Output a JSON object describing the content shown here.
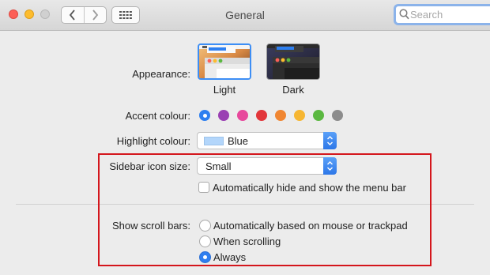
{
  "window": {
    "title": "General",
    "search": {
      "placeholder": "Search",
      "value": ""
    },
    "icons": {
      "back": "chevron-left-icon",
      "forward": "chevron-right-icon",
      "grid": "grid-icon",
      "search": "search-icon"
    }
  },
  "appearance": {
    "label": "Appearance:",
    "options": [
      {
        "name": "Light",
        "selected": true
      },
      {
        "name": "Dark",
        "selected": false
      }
    ]
  },
  "accent": {
    "label": "Accent colour:",
    "colors": [
      "#2d7ff0",
      "#9a3fb3",
      "#e7489c",
      "#e2363a",
      "#f08632",
      "#f6b632",
      "#5bb841",
      "#8c8c8c"
    ],
    "selected": 0
  },
  "highlight": {
    "label": "Highlight colour:",
    "value": "Blue",
    "chip_color": "#b3d6fb"
  },
  "sidebar": {
    "label": "Sidebar icon size:",
    "value": "Small",
    "autohide_label": "Automatically hide and show the menu bar",
    "autohide_checked": false
  },
  "scroll": {
    "label": "Show scroll bars:",
    "options": [
      {
        "label": "Automatically based on mouse or trackpad",
        "selected": false
      },
      {
        "label": "When scrolling",
        "selected": false
      },
      {
        "label": "Always",
        "selected": true
      }
    ]
  },
  "annotation_color": "#d4161c"
}
